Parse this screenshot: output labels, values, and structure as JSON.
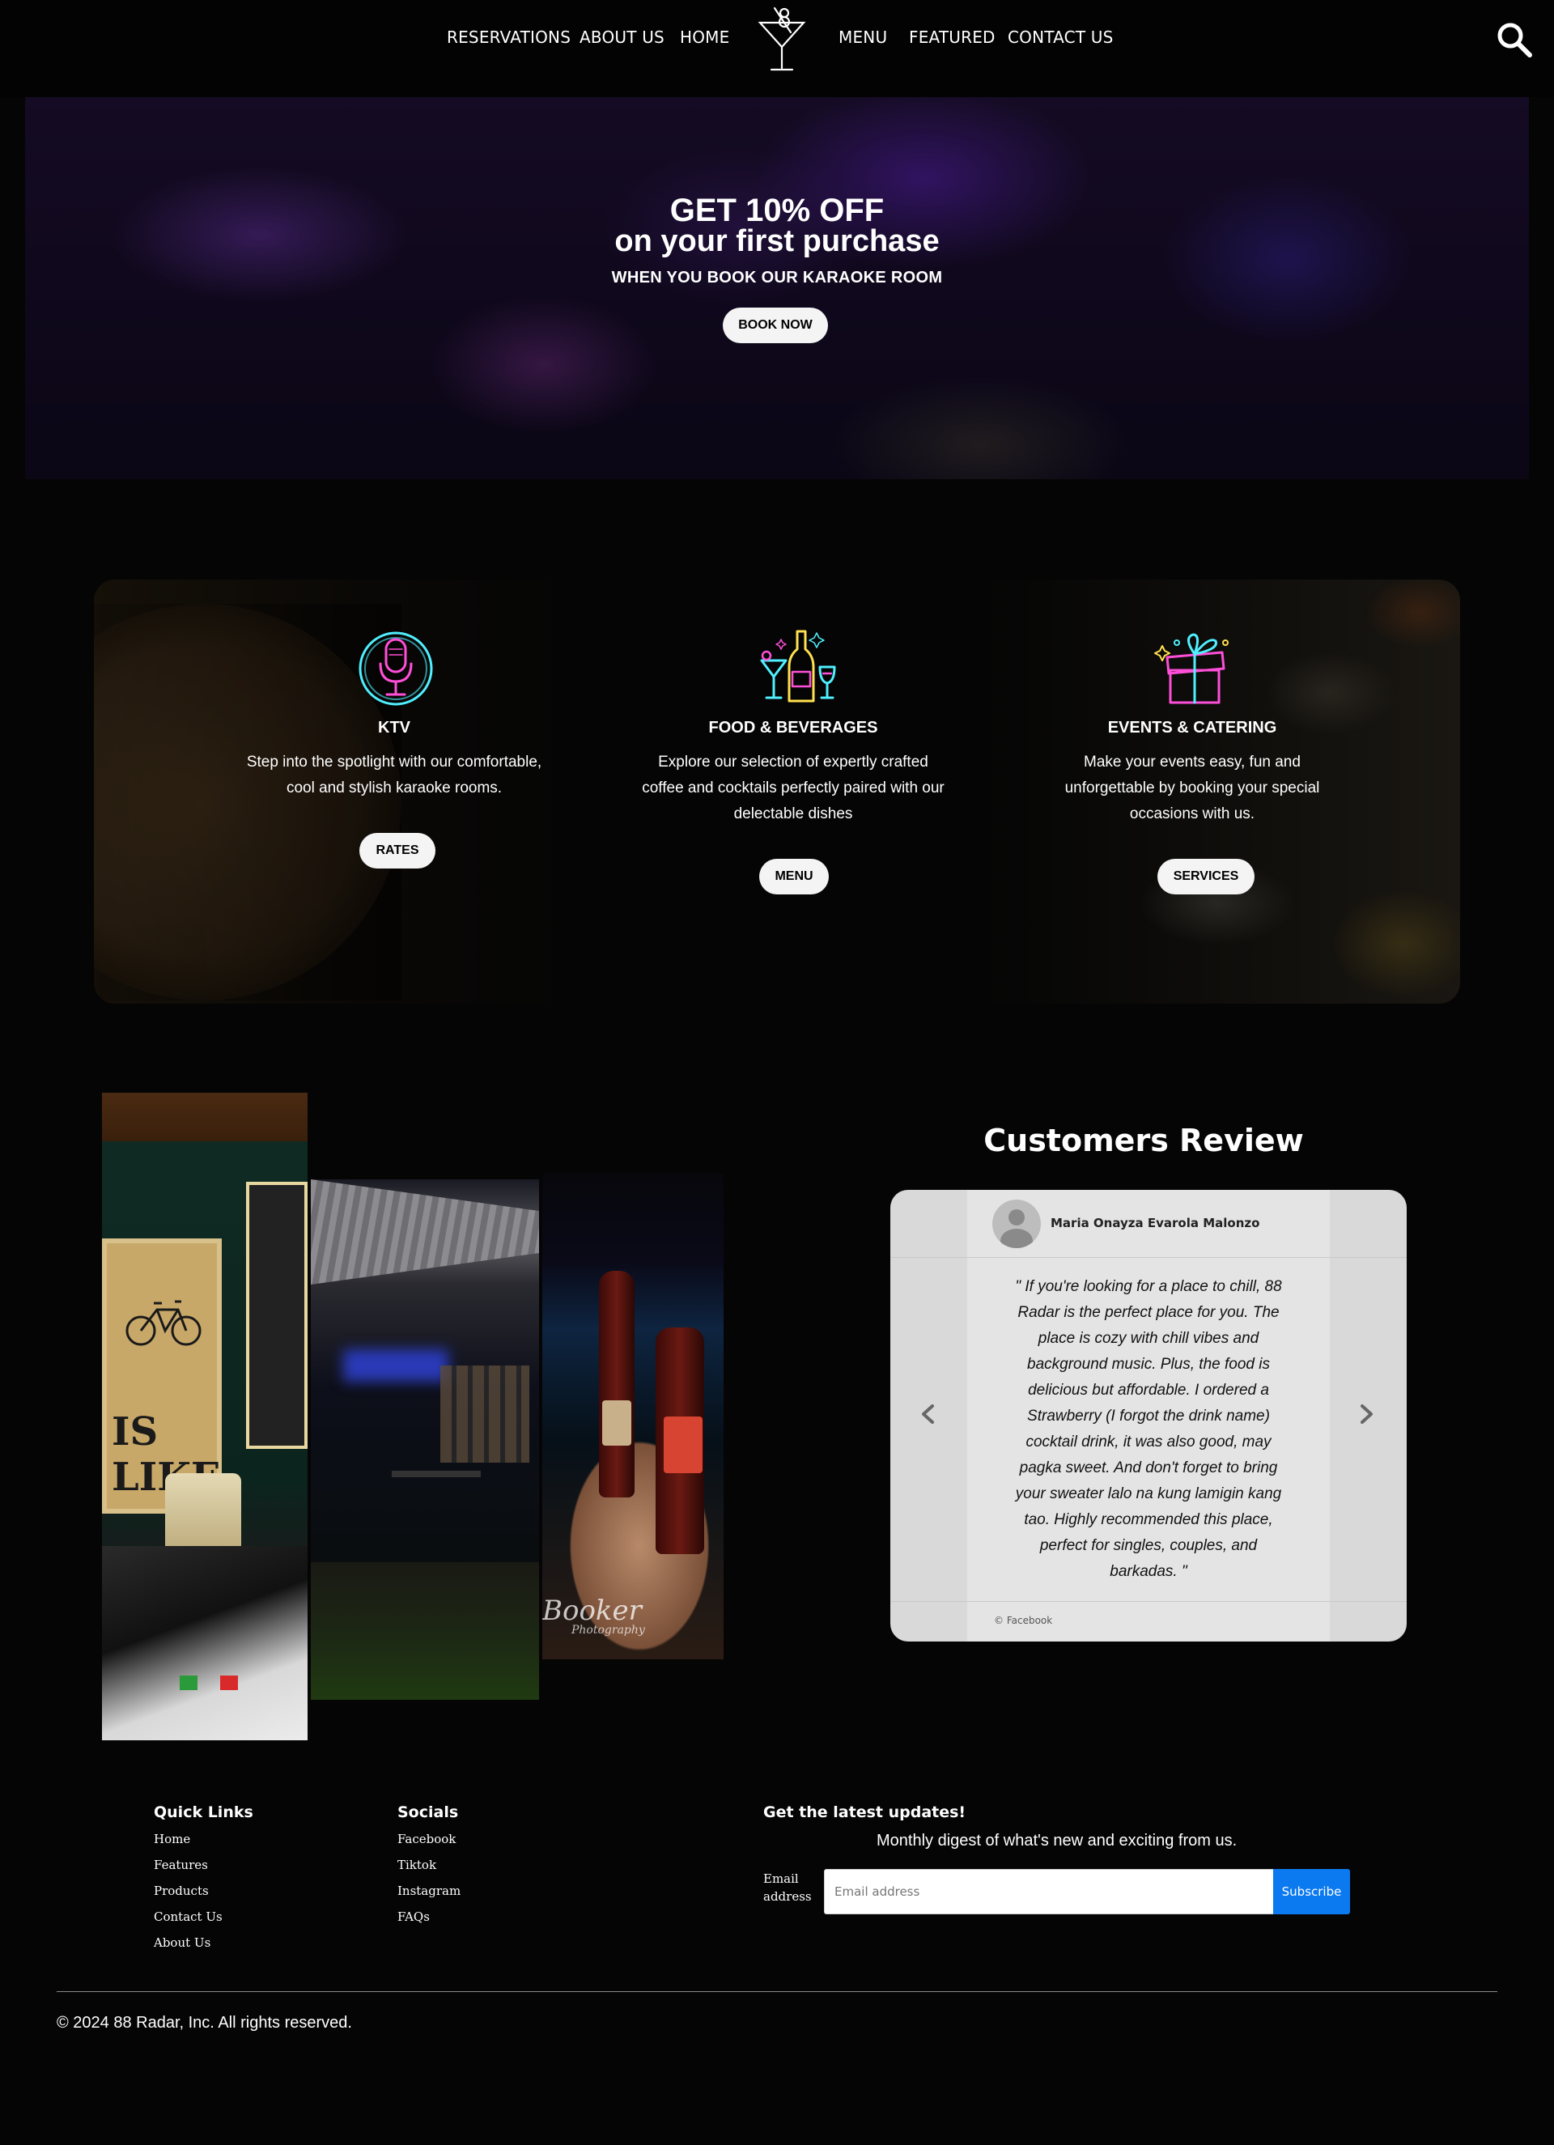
{
  "nav": {
    "links_left": [
      "RESERVATIONS",
      "ABOUT US",
      "HOME"
    ],
    "links_right": [
      "MENU",
      "FEATURED",
      "CONTACT US"
    ],
    "logo_icon": "martini-glass-icon",
    "search_icon": "search-icon"
  },
  "hero": {
    "headline": "GET 10% OFF",
    "subheadline": "on your first purchase",
    "tagline": "WHEN YOU BOOK OUR KARAOKE ROOM",
    "button_label": "BOOK NOW"
  },
  "services": {
    "items": [
      {
        "icon": "neon-microphone-icon",
        "title": "KTV",
        "description_lines": [
          "Step into the spotlight with our comfortable,",
          "cool and stylish karaoke rooms."
        ],
        "button_label": "RATES"
      },
      {
        "icon": "neon-cocktail-bottle-icon",
        "title": "FOOD & BEVERAGES",
        "description_lines": [
          "Explore our selection of expertly crafted",
          "coffee and cocktails perfectly paired with our",
          "delectable dishes"
        ],
        "button_label": "MENU"
      },
      {
        "icon": "neon-gift-box-icon",
        "title": "EVENTS & CATERING",
        "description_lines": [
          "Make your events easy, fun and",
          "unforgettable by booking your special",
          "occasions with us."
        ],
        "button_label": "SERVICES"
      }
    ]
  },
  "gallery": {
    "poster_text": "IS LIKE",
    "watermark": "Booker",
    "watermark_sub": "Photography"
  },
  "reviews": {
    "heading": "Customers Review",
    "reviewer_name": "Maria Onayza Evarola Malonzo",
    "review_lines": [
      "\" If you're looking for a place to chill, 88",
      "Radar is the perfect place for you. The",
      "place is cozy with chill vibes and",
      "background music. Plus, the food is",
      "delicious but affordable. I ordered a",
      "Strawberry (I forgot the drink name)",
      "cocktail drink, it was also good, may",
      "pagka sweet. And don't forget to bring",
      "your sweater lalo na kung lamigin kang",
      "tao. Highly recommended this place,",
      "perfect for singles, couples, and",
      "barkadas. \""
    ],
    "source": "© Facebook",
    "prev_icon": "chevron-left-icon",
    "next_icon": "chevron-right-icon"
  },
  "footer": {
    "quick_links_heading": "Quick Links",
    "quick_links": [
      "Home",
      "Features",
      "Products",
      "Contact Us",
      "About Us"
    ],
    "socials_heading": "Socials",
    "socials": [
      "Facebook",
      "Tiktok",
      "Instagram",
      "FAQs"
    ],
    "newsletter_heading": "Get the latest updates!",
    "newsletter_sub": "Monthly digest of what's new and exciting from us.",
    "email_label_line1": "Email",
    "email_label_line2": "address",
    "email_placeholder": "Email address",
    "subscribe_label": "Subscribe",
    "copyright": "© 2024 88 Radar, Inc. All rights reserved."
  },
  "colors": {
    "background": "#050505",
    "button_blue": "#0b79f0",
    "neon_pink": "#ff4fd8",
    "neon_cyan": "#4ff0ff",
    "review_card": "#d9d9d9"
  }
}
